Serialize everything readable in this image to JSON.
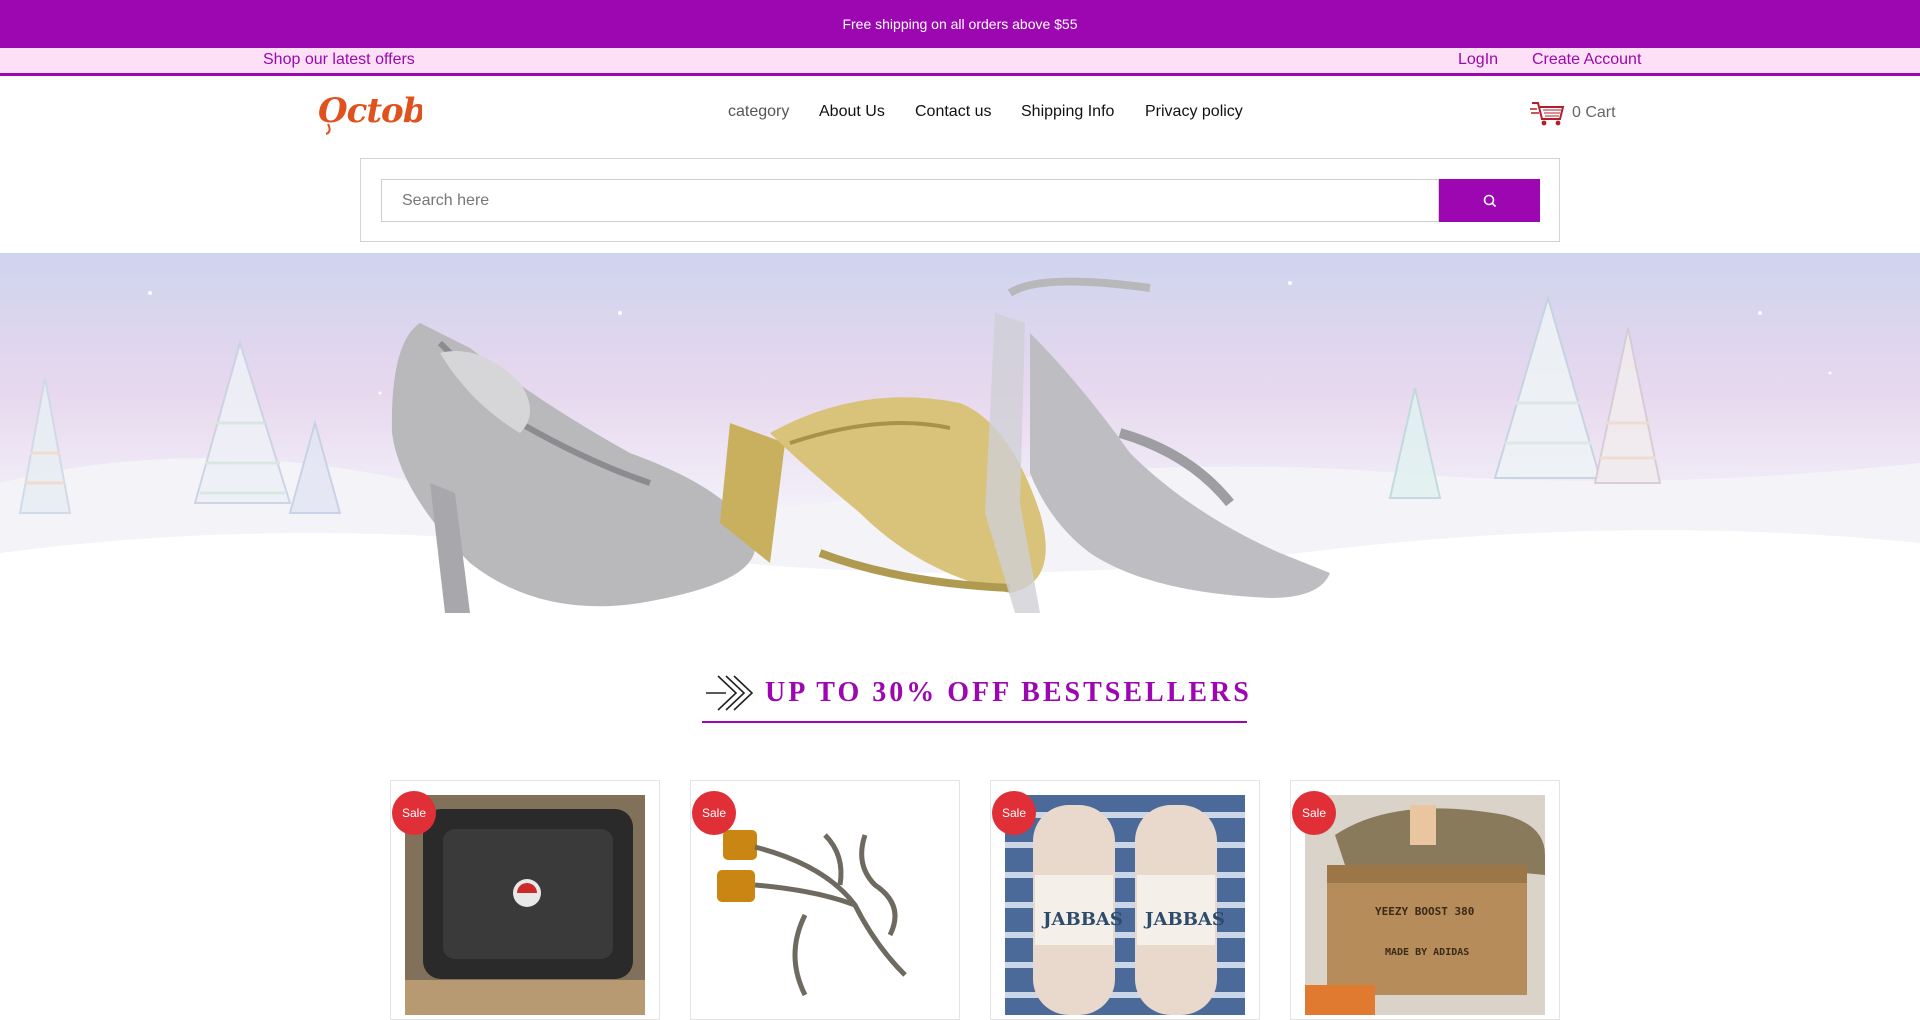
{
  "announcement": {
    "text": "Free shipping on all orders above $55"
  },
  "offers_bar": {
    "offers_link": "Shop our latest offers",
    "login": "LogIn",
    "create_account": "Create Account"
  },
  "header": {
    "logo_text": "October",
    "nav": [
      {
        "label": "category"
      },
      {
        "label": "About Us"
      },
      {
        "label": "Contact us"
      },
      {
        "label": "Shipping Info"
      },
      {
        "label": "Privacy policy"
      }
    ],
    "cart": {
      "count": "0",
      "label": "Cart",
      "text": "0 Cart"
    }
  },
  "search": {
    "placeholder": "Search here",
    "icon": "search-icon"
  },
  "hero": {
    "description": "Sparkly heels and sandals on snow with glass Christmas trees"
  },
  "section": {
    "title": "UP TO 30% OFF BESTSELLERS",
    "icon": "double-chevron-right-icon"
  },
  "products": [
    {
      "badge": "Sale"
    },
    {
      "badge": "Sale"
    },
    {
      "badge": "Sale"
    },
    {
      "badge": "Sale"
    }
  ],
  "colors": {
    "brand": "#9c07b1",
    "offers_bg": "#fde0f5",
    "sale": "#e02f37",
    "logo": "#e0521d"
  }
}
